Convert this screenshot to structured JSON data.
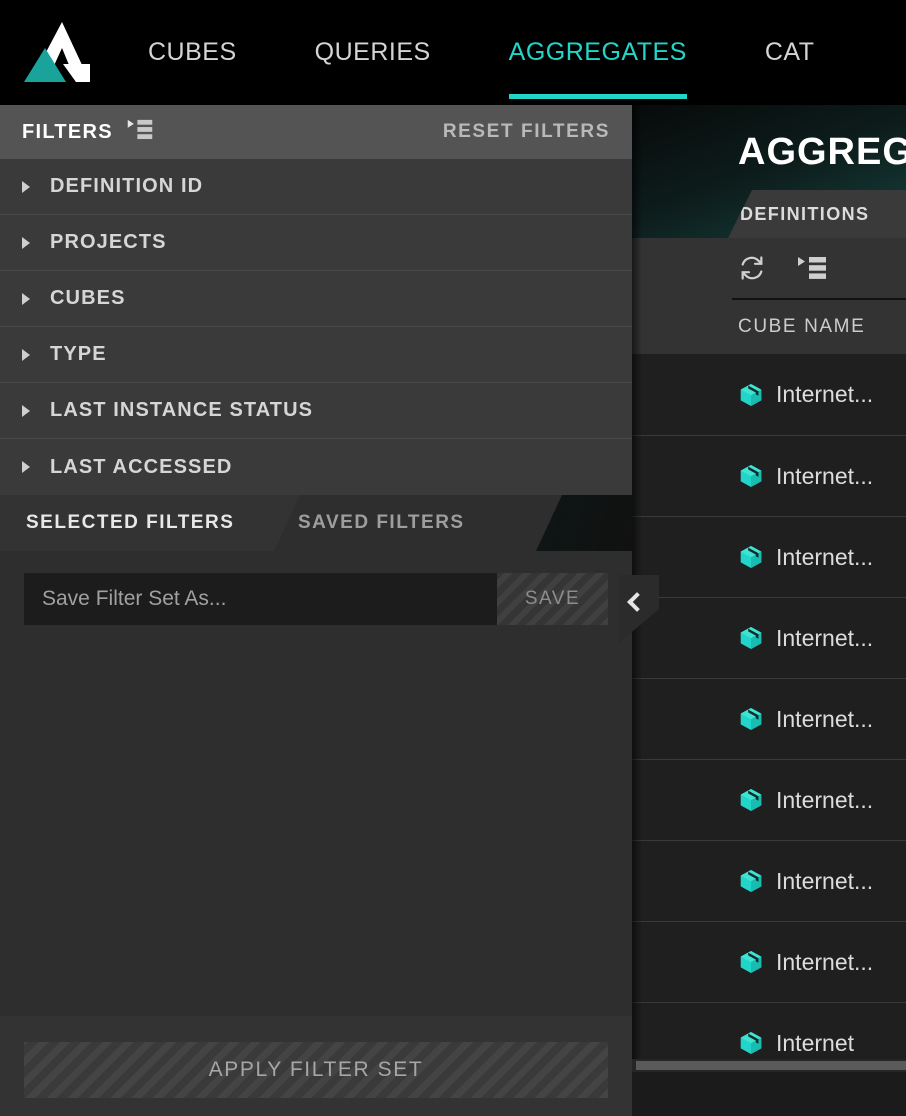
{
  "brand": {
    "logo_name": "atscale-logo",
    "accent": "#21d6c8"
  },
  "topnav": {
    "items": [
      {
        "label": "CUBES",
        "active": false
      },
      {
        "label": "QUERIES",
        "active": false
      },
      {
        "label": "AGGREGATES",
        "active": true
      },
      {
        "label": "CAT",
        "active": false
      }
    ]
  },
  "filter_panel": {
    "header": {
      "title": "FILTERS",
      "list_icon": "list-view-icon",
      "reset_label": "RESET FILTERS"
    },
    "rows": [
      {
        "label": "DEFINITION ID"
      },
      {
        "label": "PROJECTS"
      },
      {
        "label": "CUBES"
      },
      {
        "label": "TYPE"
      },
      {
        "label": "LAST INSTANCE STATUS"
      },
      {
        "label": "LAST ACCESSED"
      }
    ],
    "tabs": [
      {
        "label": "SELECTED FILTERS",
        "active": true
      },
      {
        "label": "SAVED FILTERS",
        "active": false
      }
    ],
    "save_row": {
      "input_value": "",
      "input_placeholder": "Save Filter Set As...",
      "save_label": "SAVE"
    },
    "apply_label": "APPLY FILTER SET",
    "collapse_icon": "chevron-left-icon"
  },
  "main": {
    "page_title": "AGGREG",
    "tabs": [
      {
        "label": "DEFINITIONS",
        "active": true
      }
    ],
    "toolbar": [
      {
        "icon": "refresh-icon"
      },
      {
        "icon": "list-view-icon"
      }
    ],
    "table": {
      "columns": [
        {
          "label": "CUBE NAME"
        }
      ],
      "resize_handle": "||",
      "rows": [
        {
          "icon": "cube-icon",
          "name": "Internet..."
        },
        {
          "icon": "cube-icon",
          "name": "Internet..."
        },
        {
          "icon": "cube-icon",
          "name": "Internet..."
        },
        {
          "icon": "cube-icon",
          "name": "Internet..."
        },
        {
          "icon": "cube-icon",
          "name": "Internet..."
        },
        {
          "icon": "cube-icon",
          "name": "Internet..."
        },
        {
          "icon": "cube-icon",
          "name": "Internet..."
        },
        {
          "icon": "cube-icon",
          "name": "Internet..."
        },
        {
          "icon": "cube-icon",
          "name": "Internet"
        }
      ]
    }
  }
}
